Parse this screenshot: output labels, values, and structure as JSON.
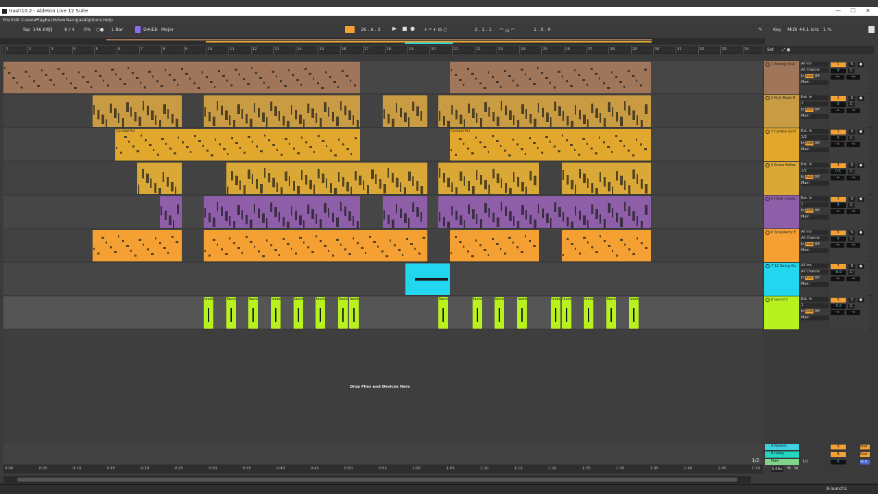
{
  "title_bar": {
    "title": "trash10.2 - Ableton Live 12 Suite",
    "minimize": "—",
    "maximize": "☐",
    "close": "✕"
  },
  "menu": [
    "File",
    "Edit",
    "Create",
    "Playback",
    "View",
    "Navigate",
    "Options",
    "Help"
  ],
  "control_bar": {
    "tap": "Tap",
    "tempo": "146.00",
    "meter": "8 / 4",
    "swing": "0%",
    "quantize": "1 Bar",
    "key": "D#/Eb",
    "scale": "Major",
    "position": "26 .  6 .  2",
    "loop_start": "2 .  1 .  1",
    "loop_length": "1 .  0 .  0",
    "key_btn": "Key",
    "midi_btn": "MIDI",
    "sample_rate": "44.1 kHz",
    "cpu": "1 %"
  },
  "ruler_bars": [
    "1",
    "2",
    "3",
    "4",
    "5",
    "6",
    "7",
    "8",
    "9",
    "10",
    "11",
    "12",
    "13",
    "14",
    "15",
    "16",
    "17",
    "18",
    "19",
    "20",
    "21",
    "22",
    "23",
    "24",
    "25",
    "26",
    "27",
    "28",
    "29",
    "30",
    "31",
    "32",
    "33",
    "34"
  ],
  "time_labels": [
    "0:00",
    "0:05",
    "0:10",
    "0:15",
    "0:20",
    "0:25",
    "0:30",
    "0:35",
    "0:40",
    "0:45",
    "0:50",
    "0:55",
    "1:00",
    "1:05",
    "1:10",
    "1:15",
    "1:20",
    "1:25",
    "1:30",
    "1:35",
    "1:40",
    "1:45",
    "1:50"
  ],
  "zoom_label": "1/2",
  "set_label": "Set",
  "drop_text": "Drop Files and Devices Here",
  "status_text": "8-launch1",
  "colors": {
    "analog": "#a0765a",
    "kick": "#c99b42",
    "cymbal": "#e2a82e",
    "snare": "#d9a836",
    "hihat": "#8e5ea8",
    "singularity": "#f5a033",
    "string": "#22d6f0",
    "launch": "#b8f21e"
  },
  "tracks": [
    {
      "num": "1",
      "name": "1 Analog Stab",
      "input": "All Ins",
      "channel": "All Channe",
      "monitor": [
        "In",
        "Auto",
        "Off"
      ],
      "output": "Main",
      "volume": "0",
      "pan": "C",
      "sends": [
        "-∞",
        "-∞"
      ]
    },
    {
      "num": "2",
      "name": "2 Kick Black H",
      "input": "Ext. In",
      "channel": "2",
      "monitor": [
        "In",
        "Auto",
        "Off"
      ],
      "output": "Main",
      "volume": "0",
      "pan": "C",
      "sends": [
        "-∞",
        "-∞"
      ]
    },
    {
      "num": "3",
      "name": "3 Cymbal Acid",
      "input": "Ext. In",
      "channel": "1/2",
      "monitor": [
        "In",
        "Auto",
        "Off"
      ],
      "output": "Main",
      "volume": "0",
      "pan": "C",
      "sends": [
        "-∞",
        "-∞"
      ]
    },
    {
      "num": "4",
      "name": "4 Snare Melbo",
      "input": "Ext. In",
      "channel": "1/2",
      "monitor": [
        "In",
        "Auto",
        "Off"
      ],
      "output": "Main",
      "volume": "0.5",
      "pan": "C",
      "sends": [
        "-∞",
        "-∞"
      ]
    },
    {
      "num": "5",
      "name": "5 Hihat Closec",
      "input": "Ext. In",
      "channel": "1",
      "monitor": [
        "In",
        "Auto",
        "Off"
      ],
      "output": "Main",
      "volume": "0",
      "pan": "C",
      "sends": [
        "-∞",
        "-∞"
      ]
    },
    {
      "num": "6",
      "name": "6 Singularity E",
      "input": "All Ins",
      "channel": "All Channe",
      "monitor": [
        "In",
        "Auto",
        "Off"
      ],
      "output": "Main",
      "volume": "0",
      "pan": "C",
      "sends": [
        "-∞",
        "-∞"
      ]
    },
    {
      "num": "7",
      "name": "7 12 String Gu",
      "input": "All Ins",
      "channel": "All Channe",
      "monitor": [
        "In",
        "Auto",
        "Off"
      ],
      "output": "Main",
      "volume": "-6.0",
      "pan": "C",
      "sends": [
        "-∞",
        "-∞"
      ]
    },
    {
      "num": "8",
      "name": "8 launch1",
      "input": "Ext. In",
      "channel": "1",
      "monitor": [
        "In",
        "Auto",
        "Off"
      ],
      "output": "Main",
      "volume": "-5.0",
      "pan": "C",
      "sends": [
        "-∞",
        "-∞"
      ]
    }
  ],
  "returns": [
    {
      "name": "A Reverb",
      "letter": "A",
      "post": "Post"
    },
    {
      "name": "B Delay",
      "letter": "B",
      "post": "Post"
    },
    {
      "name": "Main",
      "io": "1/2",
      "volume": "0",
      "vol2": "-6.0"
    }
  ],
  "clips": {
    "cymbal_label": "Cymbal Aci",
    "launch_label": "launc"
  },
  "bottom": {
    "zoom": "5.00x",
    "m": "M",
    "w": "W"
  }
}
